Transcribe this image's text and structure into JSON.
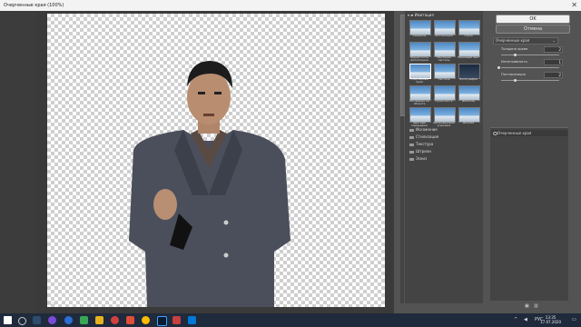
{
  "window": {
    "title": "Очерченные края (100%)"
  },
  "canvas": {
    "zoom": "66%"
  },
  "gallery": {
    "header": "Имитация",
    "thumbnails": [
      {
        "label": "Акварель"
      },
      {
        "label": "Аппликация"
      },
      {
        "label": "Губка"
      },
      {
        "label": "Зернистость фотопленки"
      },
      {
        "label": "Масляная пастель"
      },
      {
        "label": "Неоновый свет"
      },
      {
        "label": "Очерченные края"
      },
      {
        "label": "Пастель"
      },
      {
        "label": "Фотография"
      },
      {
        "label": "Рисование на обороте"
      },
      {
        "label": "Сухая кисть"
      },
      {
        "label": "Шпатель"
      },
      {
        "label": "Цветные карандаши"
      },
      {
        "label": "Целлофановая упаковка"
      },
      {
        "label": "Штрихи"
      }
    ],
    "folders": [
      "Искажение",
      "Стилизация",
      "Текстура",
      "Штрихи",
      "Эскиз"
    ]
  },
  "controls": {
    "ok": "OK",
    "cancel": "Отмена",
    "filter_select": "Очерченные края",
    "params": [
      {
        "label": "Толщина краев",
        "value": "2"
      },
      {
        "label": "Интенсивность",
        "value": "1"
      },
      {
        "label": "Постеризация",
        "value": "2"
      }
    ]
  },
  "layers": {
    "item": "Очерченные края"
  },
  "taskbar": {
    "lang": "РУС",
    "time": "13:35",
    "date": "17.07.2020"
  },
  "colors": {
    "taskbar": "#1f2b3c",
    "panel": "#535353",
    "ok_button": "#f0f0f0"
  }
}
